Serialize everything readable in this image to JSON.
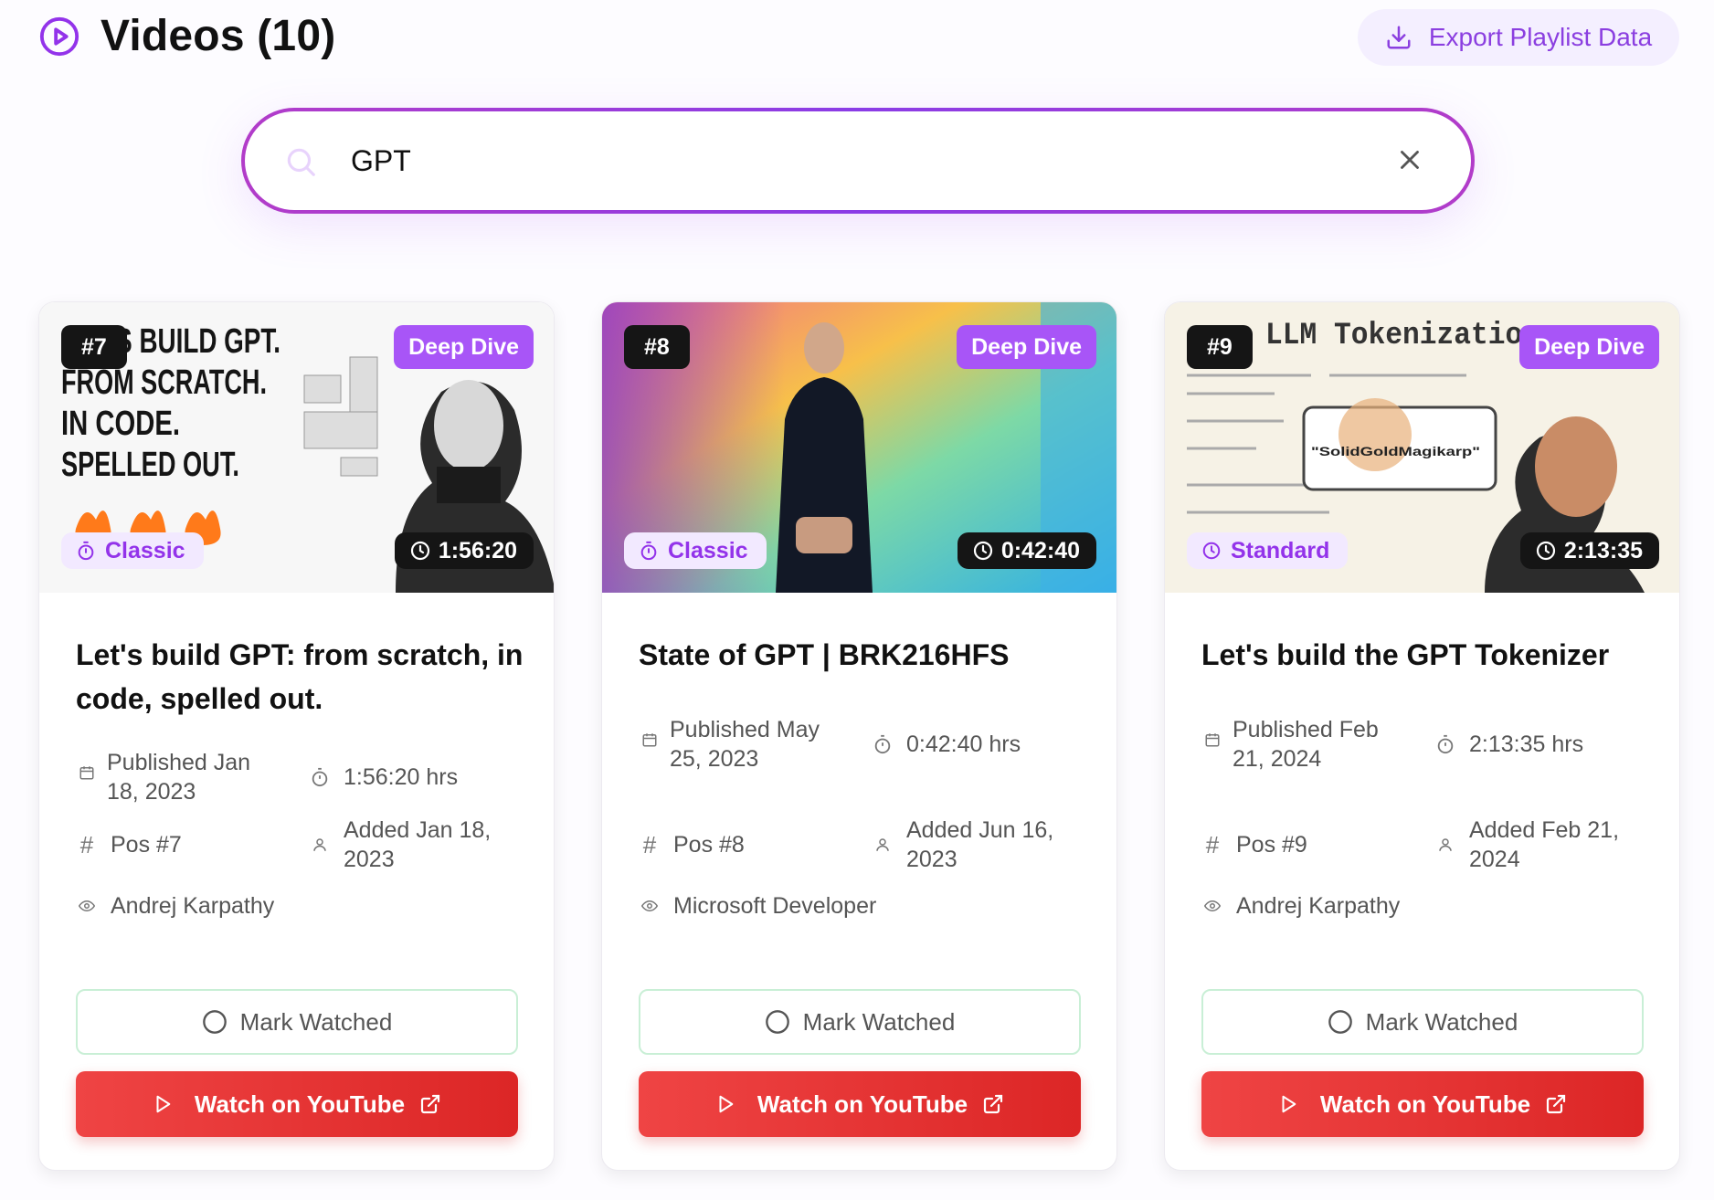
{
  "header": {
    "title": "Videos (10)",
    "export_label": "Export Playlist Data"
  },
  "search": {
    "value": "GPT"
  },
  "labels": {
    "mark_watched": "Mark Watched",
    "watch_youtube": "Watch on YouTube"
  },
  "colors": {
    "accent": "#a855f7",
    "youtube": "#dc2626",
    "dark_badge": "#151515"
  },
  "cards": [
    {
      "position_badge": "#7",
      "category": "Deep Dive",
      "type": "Classic",
      "duration": "1:56:20",
      "title": "Let's build GPT: from scratch, in code, spelled out.",
      "thumbnail_text": [
        "LET'S BUILD GPT.",
        "FROM SCRATCH.",
        "IN CODE.",
        "SPELLED OUT."
      ],
      "published": "Published Jan 18, 2023",
      "duration_hrs": "1:56:20 hrs",
      "pos": "Pos #7",
      "added": "Added Jan 18, 2023",
      "channel": "Andrej Karpathy"
    },
    {
      "position_badge": "#8",
      "category": "Deep Dive",
      "type": "Classic",
      "duration": "0:42:40",
      "title": "State of GPT | BRK216HFS",
      "published": "Published May 25, 2023",
      "duration_hrs": "0:42:40 hrs",
      "pos": "Pos #8",
      "added": "Added Jun 16, 2023",
      "channel": "Microsoft Developer"
    },
    {
      "position_badge": "#9",
      "category": "Deep Dive",
      "type": "Standard",
      "duration": "2:13:35",
      "title": "Let's build the GPT Tokenizer",
      "thumbnail_text": [
        "LLM Tokenization",
        "\"SolidGoldMagikarp\""
      ],
      "published": "Published Feb 21, 2024",
      "duration_hrs": "2:13:35 hrs",
      "pos": "Pos #9",
      "added": "Added Feb 21, 2024",
      "channel": "Andrej Karpathy"
    }
  ]
}
